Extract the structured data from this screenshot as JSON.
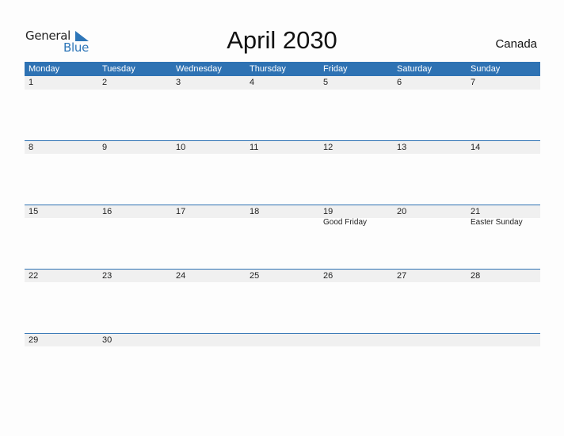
{
  "logo": {
    "word1": "General",
    "word2": "Blue"
  },
  "title": "April 2030",
  "country": "Canada",
  "colors": {
    "accent": "#2e72b3",
    "row_bg": "#f0f0f0"
  },
  "weekdays": [
    "Monday",
    "Tuesday",
    "Wednesday",
    "Thursday",
    "Friday",
    "Saturday",
    "Sunday"
  ],
  "weeks": [
    [
      {
        "day": "1"
      },
      {
        "day": "2"
      },
      {
        "day": "3"
      },
      {
        "day": "4"
      },
      {
        "day": "5"
      },
      {
        "day": "6"
      },
      {
        "day": "7"
      }
    ],
    [
      {
        "day": "8"
      },
      {
        "day": "9"
      },
      {
        "day": "10"
      },
      {
        "day": "11"
      },
      {
        "day": "12"
      },
      {
        "day": "13"
      },
      {
        "day": "14"
      }
    ],
    [
      {
        "day": "15"
      },
      {
        "day": "16"
      },
      {
        "day": "17"
      },
      {
        "day": "18"
      },
      {
        "day": "19",
        "event": "Good Friday"
      },
      {
        "day": "20"
      },
      {
        "day": "21",
        "event": "Easter Sunday"
      }
    ],
    [
      {
        "day": "22"
      },
      {
        "day": "23"
      },
      {
        "day": "24"
      },
      {
        "day": "25"
      },
      {
        "day": "26"
      },
      {
        "day": "27"
      },
      {
        "day": "28"
      }
    ],
    [
      {
        "day": "29"
      },
      {
        "day": "30"
      },
      {
        "day": ""
      },
      {
        "day": ""
      },
      {
        "day": ""
      },
      {
        "day": ""
      },
      {
        "day": ""
      }
    ]
  ]
}
